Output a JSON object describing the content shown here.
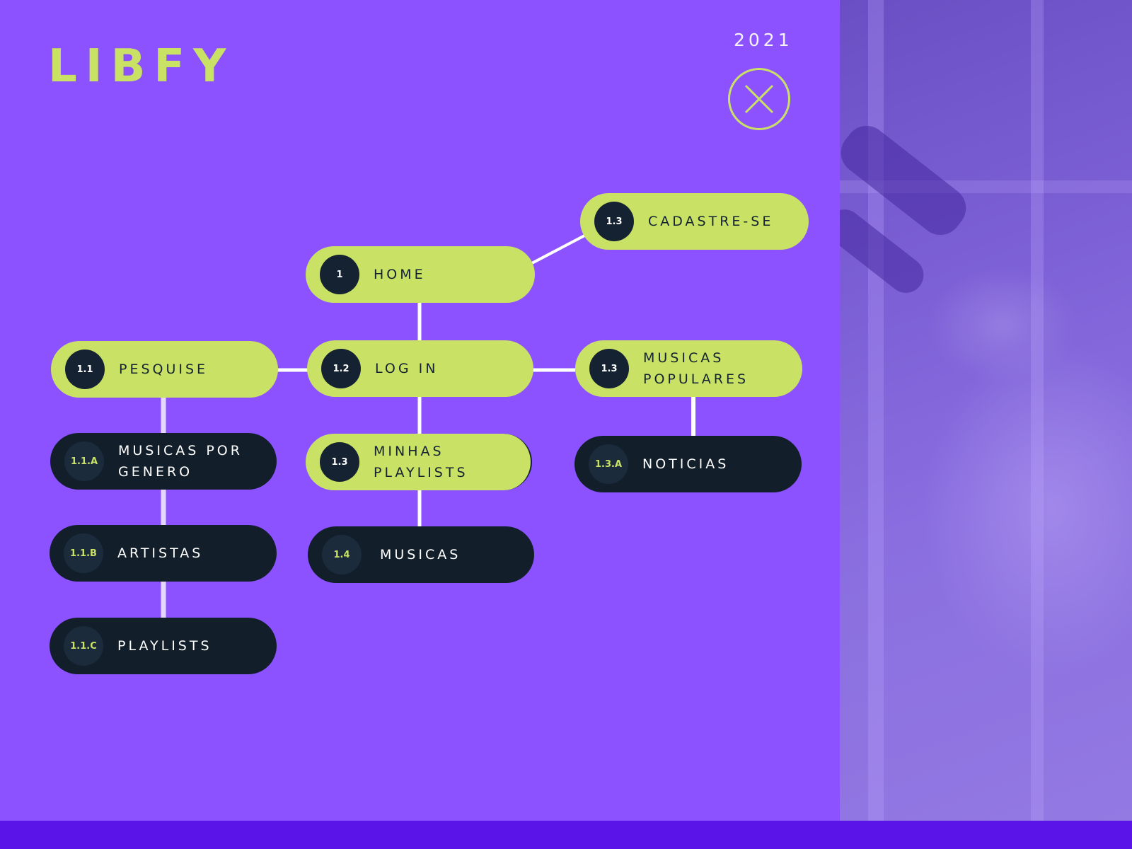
{
  "brand": {
    "logo": "LIBFY",
    "year": "2021"
  },
  "close_icon": "close-icon",
  "nodes": {
    "cadastre": {
      "number": "1.3",
      "label": "CADASTRE-SE"
    },
    "home": {
      "number": "1",
      "label": "HOME"
    },
    "pesquise": {
      "number": "1.1",
      "label": "PESQUISE"
    },
    "login": {
      "number": "1.2",
      "label": "LOG IN"
    },
    "populares": {
      "number": "1.3",
      "label_line1": "MUSICAS",
      "label_line2": "POPULARES"
    },
    "genero": {
      "number": "1.1.A",
      "label_line1": "MUSICAS POR",
      "label_line2": "GENERO"
    },
    "minhas": {
      "number": "1.3",
      "label_line1": "MINHAS",
      "label_line2": "PLAYLISTS"
    },
    "noticias": {
      "number": "1.3.A",
      "label": "NOTICIAS"
    },
    "artistas": {
      "number": "1.1.B",
      "label": "ARTISTAS"
    },
    "musicas": {
      "number": "1.4",
      "label": "MUSICAS"
    },
    "playlists": {
      "number": "1.1.C",
      "label": "PLAYLISTS"
    }
  },
  "colors": {
    "background": "#8c52ff",
    "accent": "#c9e265",
    "dark_node": "#121f2b",
    "bottom_bar": "#5a14e8"
  }
}
